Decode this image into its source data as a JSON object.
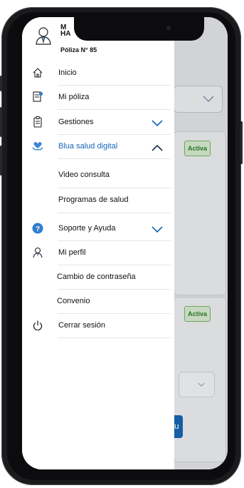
{
  "header": {
    "user_name_line1": "M",
    "user_name_line2": "HA",
    "policy_label": "Póliza N° 85"
  },
  "menu": {
    "inicio": "Inicio",
    "mi_poliza": "Mi póliza",
    "gestiones": "Gestiones",
    "blua": "Blua salud digital",
    "video": "Video consulta",
    "programas": "Programas de salud",
    "soporte": "Soporte y Ayuda",
    "perfil": "Mi perfil",
    "cambio": "Cambio de contraseña",
    "convenio": "Convenio",
    "cerrar": "Cerrar sesión"
  },
  "background": {
    "badge_1": "Activa",
    "badge_2": "Activa",
    "button_fragment": "u"
  },
  "colors": {
    "accent": "#1565b8",
    "badge_green": "#2f7d2b",
    "drawer_bg": "#ffffff"
  }
}
